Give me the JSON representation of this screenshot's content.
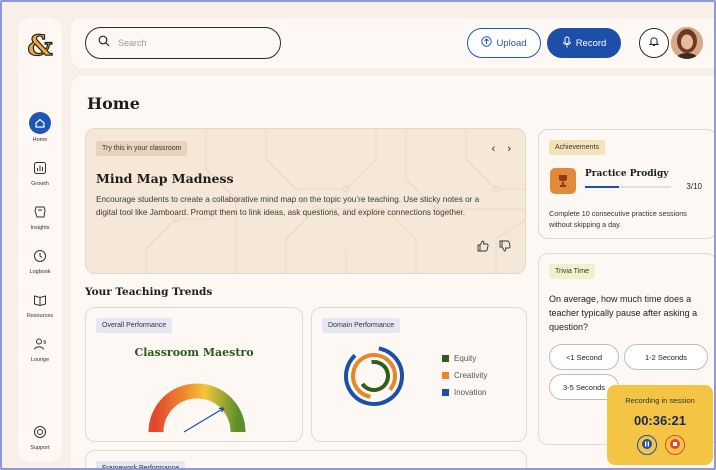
{
  "sidebar": {
    "items": [
      {
        "label": "Home",
        "icon": "home-icon"
      },
      {
        "label": "Growth",
        "icon": "growth-icon"
      },
      {
        "label": "Insights",
        "icon": "insights-icon"
      },
      {
        "label": "Logbook",
        "icon": "logbook-icon"
      },
      {
        "label": "Resources",
        "icon": "resources-icon"
      },
      {
        "label": "Lounge",
        "icon": "lounge-icon"
      },
      {
        "label": "Support",
        "icon": "support-icon"
      }
    ]
  },
  "topbar": {
    "search_placeholder": "Search",
    "upload_label": "Upload",
    "record_label": "Record"
  },
  "page": {
    "title": "Home"
  },
  "hero": {
    "chip": "Try this in your classroom",
    "title": "Mind Map Madness",
    "body": "Encourage students to create a collaborative mind map on the topic you’re teaching. Use sticky notes or a digital tool like Jamboard. Prompt them to link ideas, ask questions, and explore connections together."
  },
  "trends": {
    "title": "Your Teaching Trends",
    "overall": {
      "chip": "Overall Performance",
      "title": "Classroom Maestro"
    },
    "domain": {
      "chip": "Domain Performance",
      "legend": [
        {
          "label": "Equity",
          "color": "#2f5d1c"
        },
        {
          "label": "Creativity",
          "color": "#e9862a"
        },
        {
          "label": "Inovation",
          "color": "#1d4fa8"
        }
      ]
    },
    "framework_chip": "Framework Performance"
  },
  "achievements": {
    "chip": "Achievements",
    "title": "Practice Prodigy",
    "count": "3/10",
    "progress": 0.4,
    "desc": "Complete 10 consecutive practice sessions without skipping a day."
  },
  "trivia": {
    "chip": "Trivia Time",
    "question": "On average, how much time does a teacher typically pause after asking a question?",
    "options": [
      "<1 Second",
      "1-2 Seconds",
      "3-5 Seconds"
    ]
  },
  "recording": {
    "label": "Recording in session",
    "time": "00:36:21"
  },
  "colors": {
    "accent": "#1d4fa8",
    "recording": "#f4c445",
    "stop": "#e0492e"
  }
}
